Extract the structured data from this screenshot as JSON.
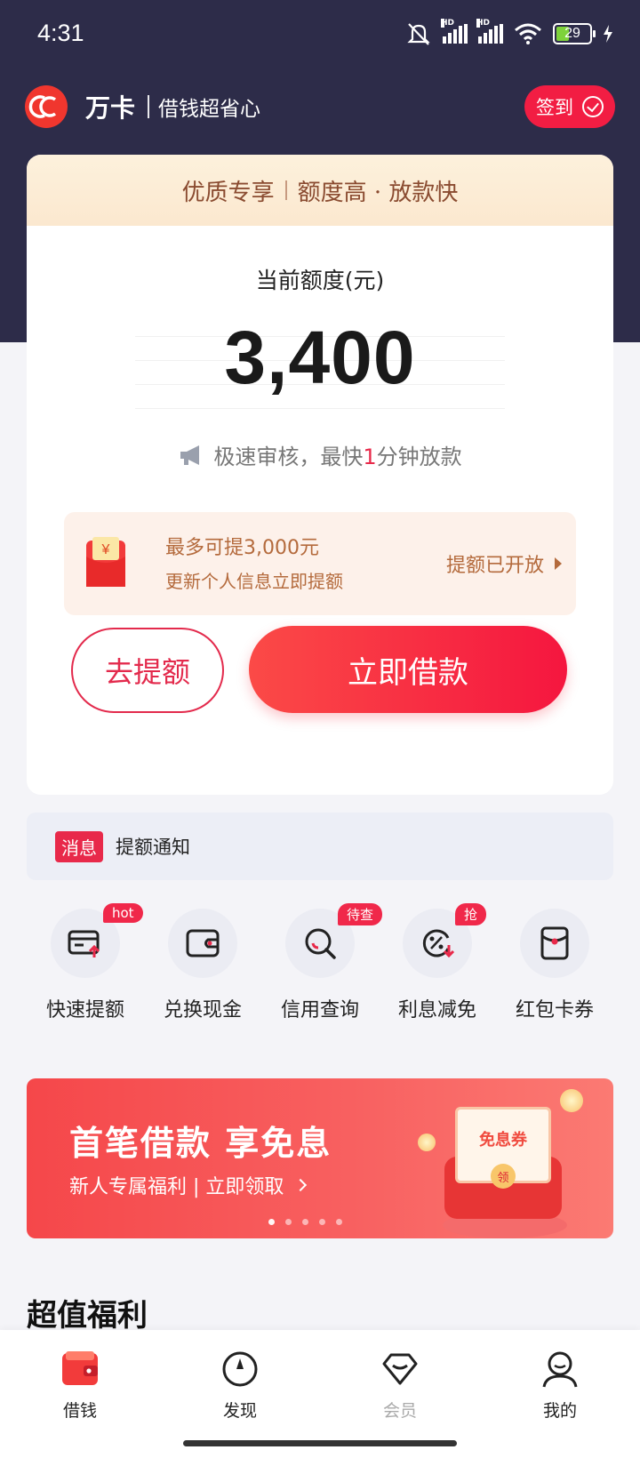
{
  "status_bar": {
    "time": "4:31",
    "battery": "29",
    "network_label": "HD"
  },
  "header": {
    "app_name": "万卡",
    "slogan": "借钱超省心",
    "signin_label": "签到"
  },
  "card": {
    "banner_left": "优质专享",
    "banner_right": "额度高 · 放款快",
    "credit_label": "当前额度(元)",
    "credit_amount": "3,400",
    "notice_prefix": "极速审核，最快",
    "notice_highlight": "1",
    "notice_suffix": "分钟放款",
    "promo": {
      "title": "最多可提3,000元",
      "subtitle": "更新个人信息立即提额",
      "action": "提额已开放",
      "envelope_symbol": "¥"
    },
    "raise_button": "去提额",
    "borrow_button": "立即借款"
  },
  "message": {
    "tag": "消息",
    "text": "提额通知"
  },
  "quick_entries": [
    {
      "label": "快速提额",
      "badge": "hot",
      "icon": "card-upload-icon"
    },
    {
      "label": "兑换现金",
      "badge": "",
      "icon": "wallet-icon"
    },
    {
      "label": "信用查询",
      "badge": "待查",
      "icon": "search-credit-icon"
    },
    {
      "label": "利息减免",
      "badge": "抢",
      "icon": "discount-icon"
    },
    {
      "label": "红包卡券",
      "badge": "",
      "icon": "red-envelope-icon"
    }
  ],
  "ad": {
    "title": "首笔借款 享免息",
    "subtitle": "新人专属福利 | 立即领取",
    "coupon_label": "免息券",
    "seal": "领",
    "carousel_total": 5,
    "carousel_active": 1
  },
  "section_title": "超值福利",
  "bottom_nav": [
    {
      "label": "借钱",
      "icon": "wallet-icon",
      "active": true
    },
    {
      "label": "发现",
      "icon": "compass-icon",
      "active": false
    },
    {
      "label": "会员",
      "icon": "diamond-icon",
      "active": false
    },
    {
      "label": "我的",
      "icon": "user-icon",
      "active": false
    }
  ],
  "colors": {
    "header_bg": "#2d2c49",
    "accent": "#f5163f",
    "promo_text": "#b46a3c"
  }
}
